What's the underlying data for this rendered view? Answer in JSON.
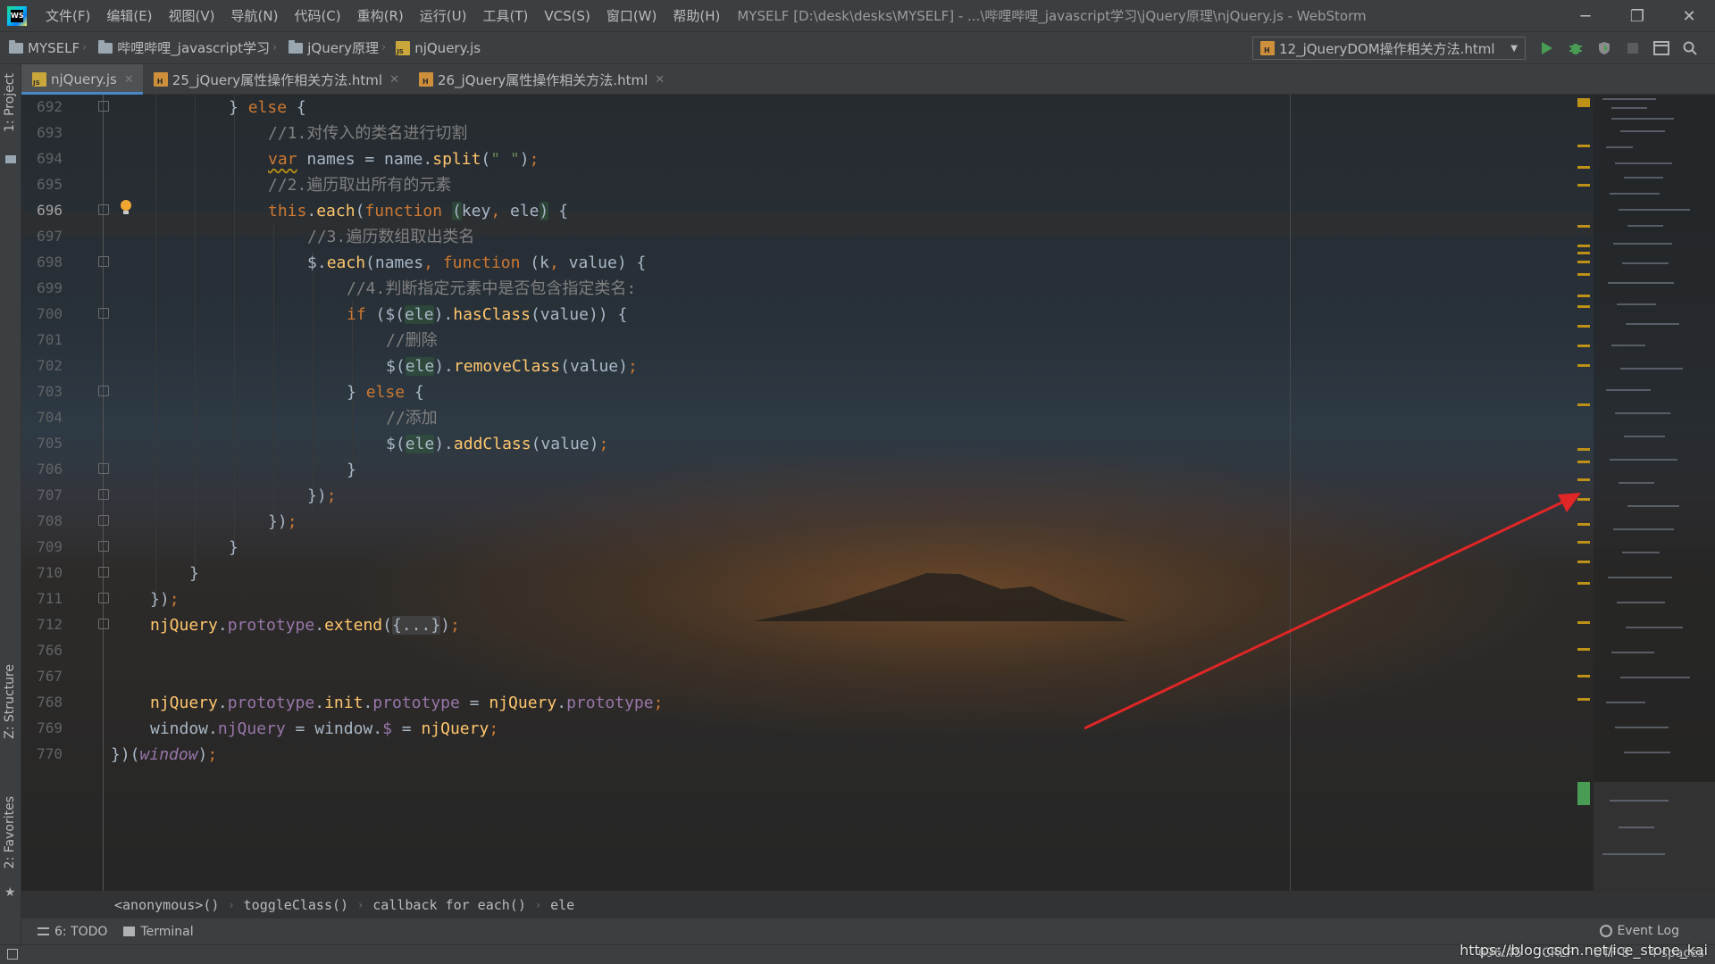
{
  "app": {
    "window_title": "MYSELF [D:\\desk\\desks\\MYSELF] - ...\\哔哩哔哩_javascript学习\\jQuery原理\\njQuery.js - WebStorm",
    "logo_text": "WS"
  },
  "menu": [
    "文件(F)",
    "编辑(E)",
    "视图(V)",
    "导航(N)",
    "代码(C)",
    "重构(R)",
    "运行(U)",
    "工具(T)",
    "VCS(S)",
    "窗口(W)",
    "帮助(H)"
  ],
  "window_controls": {
    "minimize": "─",
    "restore": "❐",
    "close": "✕"
  },
  "breadcrumb": [
    "MYSELF",
    "哔哩哔哩_javascript学习",
    "jQuery原理",
    "njQuery.js"
  ],
  "run_config": {
    "label": "12_jQueryDOM操作相关方法.html"
  },
  "left_stripe": {
    "project": "1: Project",
    "structure": "Z: Structure",
    "favorites": "2: Favorites"
  },
  "tabs": [
    {
      "label": "njQuery.js",
      "type": "js",
      "active": true
    },
    {
      "label": "25_jQuery属性操作相关方法.html",
      "type": "html",
      "active": false
    },
    {
      "label": "26_jQuery属性操作相关方法.html",
      "type": "html",
      "active": false
    }
  ],
  "editor": {
    "current_line": "696",
    "line_numbers": [
      "692",
      "693",
      "694",
      "695",
      "696",
      "697",
      "698",
      "699",
      "700",
      "701",
      "702",
      "703",
      "704",
      "705",
      "706",
      "707",
      "708",
      "709",
      "710",
      "711",
      "712",
      "766",
      "767",
      "768",
      "769",
      "770"
    ]
  },
  "code_breadcrumb": [
    "<anonymous>()",
    "toggleClass()",
    "callback for each()",
    "ele"
  ],
  "tool_windows": {
    "todo": "6: TODO",
    "terminal": "Terminal",
    "event_log": "Event Log"
  },
  "status": {
    "position": "696:45",
    "line_sep": "CRLF",
    "encoding": "UTF-8",
    "indent": "4 spaces",
    "watermark": "https://blog.csdn.net/ice_stone_kai"
  }
}
